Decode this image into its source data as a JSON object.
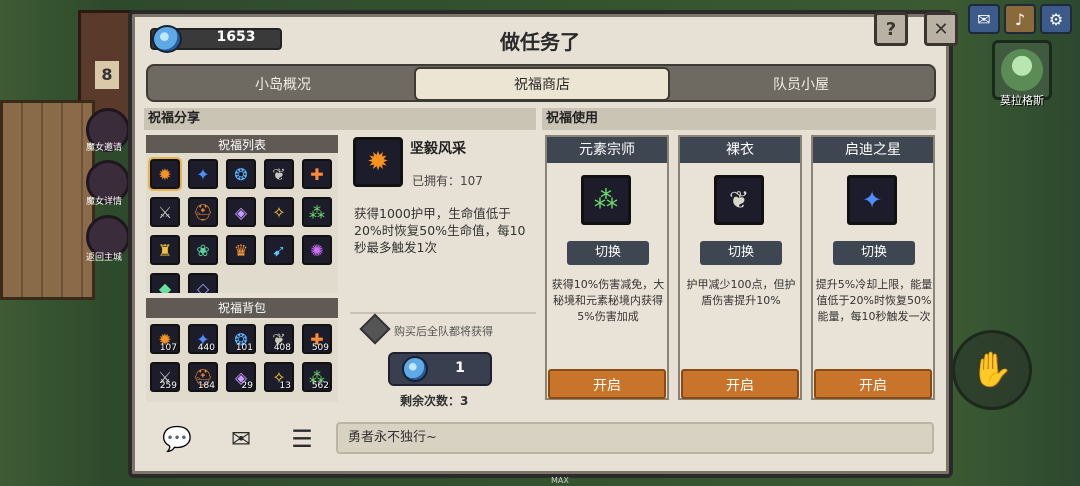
{
  "currency": {
    "value": "1653"
  },
  "title": "做任务了",
  "top_buttons": {
    "help": "?",
    "close": "✕"
  },
  "tabs": [
    {
      "label": "小岛概况",
      "active": false
    },
    {
      "label": "祝福商店",
      "active": true
    },
    {
      "label": "队员小屋",
      "active": false
    }
  ],
  "share": {
    "header": "祝福分享",
    "list_title": "祝福列表",
    "bag_title": "祝福背包",
    "bag_counts": [
      "107",
      "440",
      "101",
      "408",
      "509",
      "259",
      "184",
      "29",
      "13",
      "562"
    ]
  },
  "detail": {
    "name": "坚毅风采",
    "owned": "已拥有：107",
    "desc": "获得1000护甲，生命值低于20%时恢复50%生命值，每10秒最多触发1次",
    "hint": "购买后全队都将获得",
    "price": "1",
    "remaining": "剩余次数：3"
  },
  "use": {
    "header": "祝福使用",
    "cards": [
      {
        "name": "元素宗师",
        "swap": "切换",
        "desc": "获得10%伤害减免，大秘境和元素秘境内获得5%伤害加成",
        "button": "开启"
      },
      {
        "name": "裸衣",
        "swap": "切换",
        "desc": "护甲减少100点，但护盾伤害提升10%",
        "button": "开启"
      },
      {
        "name": "启迪之星",
        "swap": "切换",
        "desc": "提升5%冷却上限，能量值低于20%时恢复50%能量，每10秒触发一次",
        "button": "开启"
      }
    ]
  },
  "chat": {
    "text": "勇者永不独行~"
  },
  "hud": {
    "max": "MAX",
    "avatar_name": "莫拉格斯",
    "house_number": "8",
    "left_labels": [
      "魔女邀请",
      "魔女详情",
      "返回主城"
    ]
  },
  "colors": {
    "accent": "#c8742a",
    "panel": "#e6e1d4",
    "dark": "#3e4652"
  }
}
